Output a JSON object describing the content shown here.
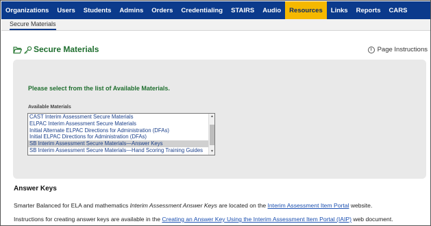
{
  "nav": {
    "items": [
      "Organizations",
      "Users",
      "Students",
      "Admins",
      "Orders",
      "Credentialing",
      "STAIRS",
      "Audio",
      "Resources",
      "Links",
      "Reports",
      "CARS"
    ],
    "active": "Resources"
  },
  "subnav": {
    "item": "Secure Materials"
  },
  "page": {
    "title": "Secure Materials",
    "instructions_label": "Page Instructions",
    "info_glyph": "i"
  },
  "panel": {
    "prompt": "Please select from the list of Available Materials.",
    "available_label": "Available Materials",
    "options": [
      "CAST Interim Assessment Secure Materials",
      "ELPAC Interim Assessment Secure Materials",
      "Initial Alternate ELPAC Directions for Administration (DFAs)",
      "Initial ELPAC Directions for Administration (DFAs)",
      "SB Interim Assessment Secure Materials—Answer Keys",
      "SB Interim Assessment Secure Materials—Hand Scoring Training Guides"
    ],
    "selected_index": 4
  },
  "answer_keys": {
    "heading": "Answer Keys",
    "line1_pre": "Smarter Balanced for ELA and mathematics ",
    "line1_em": "Interim Assessment Answer Keys",
    "line1_mid": " are located on the ",
    "line1_link": "Interim Assessment Item Portal",
    "line1_post": " website.",
    "line2_pre": "Instructions for creating answer keys are available in the ",
    "line2_link": "Creating an Answer Key Using the Interim Assessment Item Portal (IAIP)",
    "line2_post": " web document."
  },
  "colors": {
    "nav_bg": "#0b3a8c",
    "nav_active": "#f5b800",
    "title_green": "#1e6e2e",
    "link_blue": "#1a4fb0"
  },
  "icons": [
    "folder-open-icon",
    "key-icon",
    "info-icon",
    "scroll-up-icon",
    "scroll-down-icon"
  ]
}
